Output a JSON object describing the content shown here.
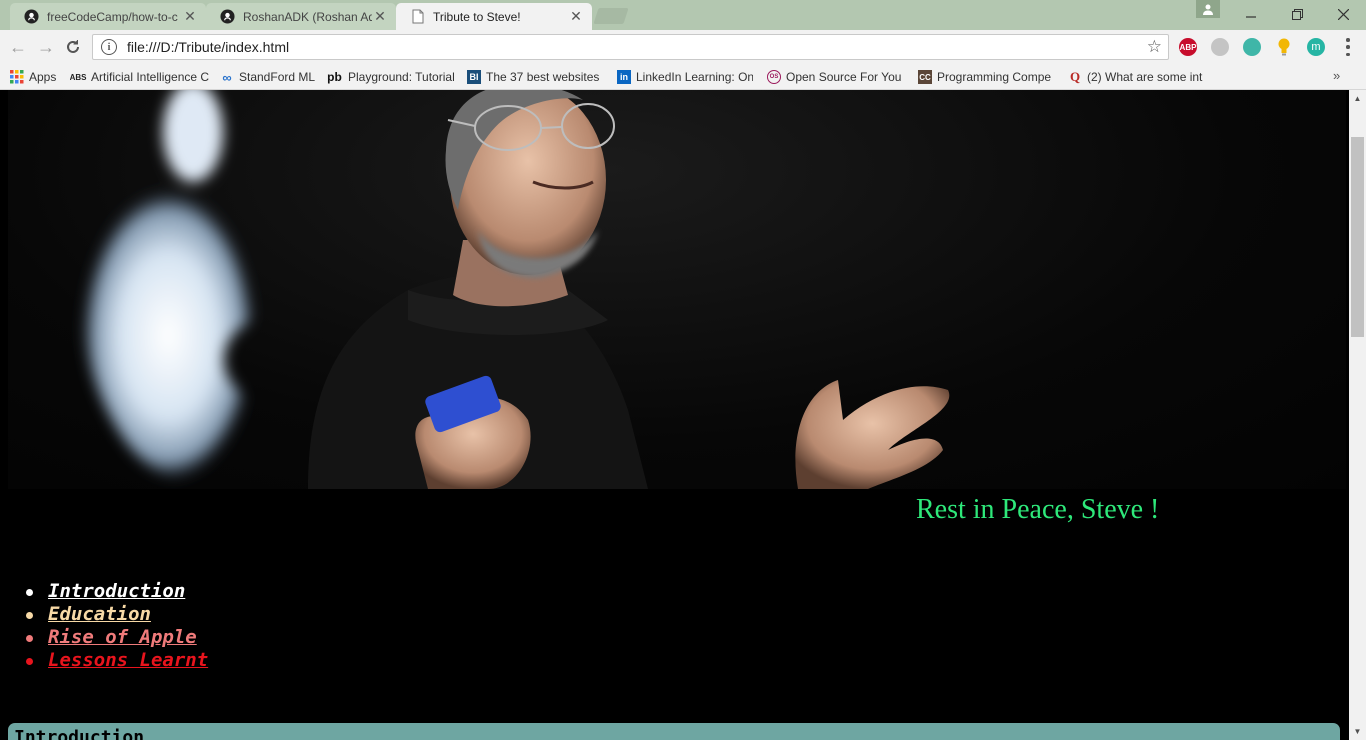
{
  "browser": {
    "tabs": [
      {
        "title": "freeCodeCamp/how-to-c",
        "icon": "github-icon"
      },
      {
        "title": "RoshanADK (Roshan Adh",
        "icon": "github-icon"
      },
      {
        "title": "Tribute to Steve!",
        "icon": "document-icon",
        "active": true
      }
    ],
    "address": "file:///D:/Tribute/index.html",
    "extensions": [
      {
        "name": "adblock-plus-icon",
        "label": "ABP",
        "color": "#c70d2c"
      },
      {
        "name": "disabled-extension-icon",
        "label": "",
        "color": "#b8b8b8"
      },
      {
        "name": "extension-icon",
        "label": "",
        "color": "#3fb6a8"
      },
      {
        "name": "lightbulb-icon",
        "label": "",
        "color": "#f2b705"
      },
      {
        "name": "m-extension-icon",
        "label": "m",
        "color": "#26b5a4"
      }
    ]
  },
  "bookmarks": [
    {
      "label": "Apps",
      "icon": "apps-grid-icon"
    },
    {
      "label": "Artificial Intelligence C",
      "icon": "abs-icon"
    },
    {
      "label": "StandFord ML",
      "icon": "coursera-icon"
    },
    {
      "label": "Playground: Tutorial",
      "icon": "pb-icon"
    },
    {
      "label": "The 37 best websites",
      "icon": "bi-icon"
    },
    {
      "label": "LinkedIn Learning: On",
      "icon": "linkedin-icon"
    },
    {
      "label": "Open Source For You",
      "icon": "osfy-icon"
    },
    {
      "label": "Programming Compe",
      "icon": "codechef-icon"
    },
    {
      "label": "(2) What are some int",
      "icon": "quora-icon"
    }
  ],
  "page": {
    "caption": "Rest in Peace, Steve !",
    "nav": [
      {
        "label": "Introduction",
        "color": "#ffffff"
      },
      {
        "label": "Education",
        "color": "#f7d9a6"
      },
      {
        "label": "Rise of Apple",
        "color": "#f07b7b"
      },
      {
        "label": "Lessons Learnt",
        "color": "#e8141d"
      }
    ],
    "section_title": "Introduction"
  }
}
